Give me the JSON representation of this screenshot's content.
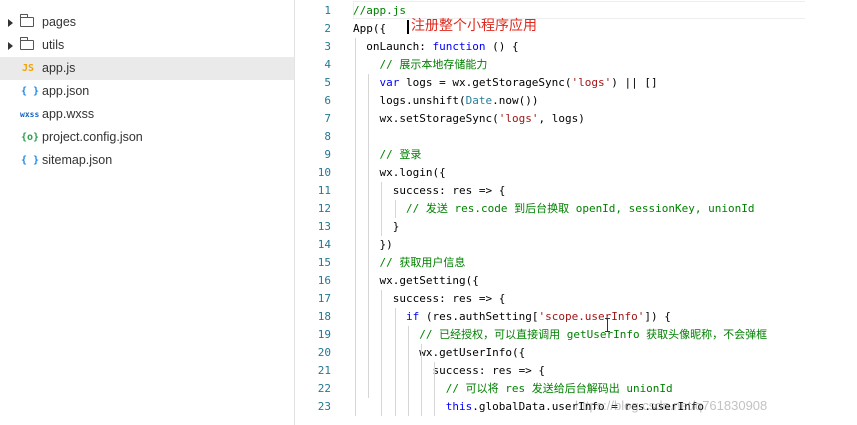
{
  "file_tree": {
    "items": [
      {
        "type": "folder",
        "label": "pages",
        "icon": "folder-icon"
      },
      {
        "type": "folder",
        "label": "utils",
        "icon": "folder-icon"
      },
      {
        "type": "file",
        "label": "app.js",
        "icon_text": "JS",
        "icon_color": "#f0a30a",
        "selected": true
      },
      {
        "type": "file",
        "label": "app.json",
        "icon_text": "{ }",
        "icon_color": "#1e88e5"
      },
      {
        "type": "file",
        "label": "app.wxss",
        "icon_text": "wxss",
        "icon_color": "#1565c0"
      },
      {
        "type": "file",
        "label": "project.config.json",
        "icon_text": "{o}",
        "icon_color": "#2e9e4b"
      },
      {
        "type": "file",
        "label": "sitemap.json",
        "icon_text": "{ }",
        "icon_color": "#1e88e5"
      }
    ]
  },
  "editor": {
    "line_numbers": [
      "1",
      "2",
      "3",
      "4",
      "5",
      "6",
      "7",
      "8",
      "9",
      "10",
      "11",
      "12",
      "13",
      "14",
      "15",
      "16",
      "17",
      "18",
      "19",
      "20",
      "21",
      "22",
      "23"
    ],
    "lines": [
      [
        [
          "cm",
          "//app.js"
        ]
      ],
      [
        [
          "pl",
          "App({"
        ]
      ],
      [
        [
          "pl",
          "  onLaunch: "
        ],
        [
          "kw",
          "function"
        ],
        [
          "pl",
          " () {"
        ]
      ],
      [
        [
          "cm",
          "    // 展示本地存储能力"
        ]
      ],
      [
        [
          "kw",
          "    var"
        ],
        [
          "pl",
          " logs = wx.getStorageSync("
        ],
        [
          "str",
          "'logs'"
        ],
        [
          "pl",
          ") || []"
        ]
      ],
      [
        [
          "pl",
          "    logs.unshift("
        ],
        [
          "cls",
          "Date"
        ],
        [
          "pl",
          ".now())"
        ]
      ],
      [
        [
          "pl",
          "    wx.setStorageSync("
        ],
        [
          "str",
          "'logs'"
        ],
        [
          "pl",
          ", logs)"
        ]
      ],
      [],
      [
        [
          "cm",
          "    // 登录"
        ]
      ],
      [
        [
          "pl",
          "    wx.login({"
        ]
      ],
      [
        [
          "pl",
          "      success: res => {"
        ]
      ],
      [
        [
          "cm",
          "        // 发送 res.code 到后台换取 openId, sessionKey, unionId"
        ]
      ],
      [
        [
          "pl",
          "      }"
        ]
      ],
      [
        [
          "pl",
          "    })"
        ]
      ],
      [
        [
          "cm",
          "    // 获取用户信息"
        ]
      ],
      [
        [
          "pl",
          "    wx.getSetting({"
        ]
      ],
      [
        [
          "pl",
          "      success: res => {"
        ]
      ],
      [
        [
          "kw",
          "        if"
        ],
        [
          "pl",
          " (res.authSetting["
        ],
        [
          "str",
          "'scope.userInfo'"
        ],
        [
          "pl",
          "]) {"
        ]
      ],
      [
        [
          "cm",
          "          // 已经授权，可以直接调用 getUserInfo 获取头像昵称，不会弹框"
        ]
      ],
      [
        [
          "pl",
          "          wx.getUserInfo({"
        ]
      ],
      [
        [
          "pl",
          "            success: res => {"
        ]
      ],
      [
        [
          "cm",
          "              // 可以将 res 发送给后台解码出 unionId"
        ]
      ],
      [
        [
          "kw",
          "              this"
        ],
        [
          "pl",
          ".globalData.userInfo = res.userInfo"
        ]
      ]
    ],
    "annotation": "注册整个小程序应用"
  },
  "watermark": "https://blog.csdn.net/q761830908"
}
